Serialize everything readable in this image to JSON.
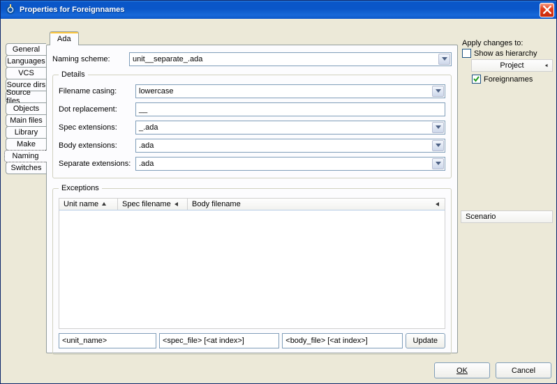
{
  "window": {
    "title": "Properties for Foreignnames"
  },
  "left_tabs": [
    "General",
    "Languages",
    "VCS",
    "Source dirs",
    "Source files",
    "Objects",
    "Main files",
    "Library",
    "Make",
    "Naming",
    "Switches"
  ],
  "left_selected_index": 9,
  "inner_tab": "Ada",
  "naming_scheme": {
    "label": "Naming scheme:",
    "value": "unit__separate_.ada"
  },
  "details": {
    "legend": "Details",
    "filename_casing": {
      "label": "Filename casing:",
      "value": "lowercase"
    },
    "dot_replacement": {
      "label": "Dot replacement:",
      "value": "__"
    },
    "spec_ext": {
      "label": "Spec extensions:",
      "value": "_.ada"
    },
    "body_ext": {
      "label": "Body extensions:",
      "value": ".ada"
    },
    "sep_ext": {
      "label": "Separate extensions:",
      "value": ".ada"
    }
  },
  "exceptions": {
    "legend": "Exceptions",
    "cols": [
      "Unit name",
      "Spec filename",
      "Body filename"
    ],
    "unit_name_ph": "<unit_name>",
    "spec_ph": "<spec_file> [<at index>]",
    "body_ph": "<body_file> [<at index>]",
    "update_btn": "Update"
  },
  "right": {
    "apply_label": "Apply changes to:",
    "show_hierarchy": "Show as hierarchy",
    "project_dd": "Project",
    "tree_item": "Foreignnames",
    "scenario": "Scenario"
  },
  "footer": {
    "ok": "OK",
    "cancel": "Cancel"
  }
}
